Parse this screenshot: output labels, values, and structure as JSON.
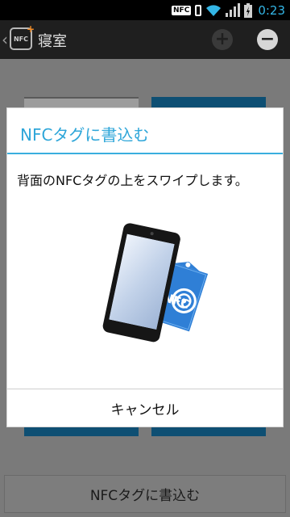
{
  "status_bar": {
    "nfc_label": "NFC",
    "time": "0:23",
    "accent_color": "#33b5e5"
  },
  "action_bar": {
    "title": "寝室",
    "app_icon_text": "NFC",
    "add_icon": "plus-circle-icon",
    "remove_icon": "minus-circle-icon"
  },
  "background": {
    "bottom_button_label": "NFCタグに書込む"
  },
  "dialog": {
    "title": "NFCタグに書込む",
    "message": "背面のNFCタグの上をスワイプします。",
    "illustration_tag_text": "NFC",
    "cancel_label": "キャンセル",
    "accent_color": "#2ea6d9"
  }
}
